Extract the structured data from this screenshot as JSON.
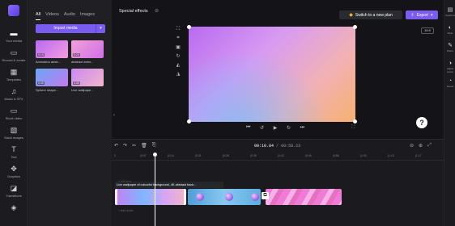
{
  "left_nav": [
    {
      "icon": "folder-icon",
      "label": "Your media",
      "glyph": "▬"
    },
    {
      "icon": "record-icon",
      "label": "Record & create",
      "glyph": "▭"
    },
    {
      "icon": "templates-icon",
      "label": "Templates",
      "glyph": "▦"
    },
    {
      "icon": "music-icon",
      "label": "Music & SFX",
      "glyph": "♫"
    },
    {
      "icon": "stock-video-icon",
      "label": "Stock video",
      "glyph": "▭"
    },
    {
      "icon": "stock-images-icon",
      "label": "Stock images",
      "glyph": "▧"
    },
    {
      "icon": "text-icon",
      "label": "Text",
      "glyph": "T"
    },
    {
      "icon": "graphics-icon",
      "label": "Graphics",
      "glyph": "✥"
    },
    {
      "icon": "transitions-icon",
      "label": "Transitions",
      "glyph": "◪"
    },
    {
      "icon": "brand-icon",
      "label": "",
      "glyph": "◈"
    }
  ],
  "media_panel": {
    "tabs": [
      "All",
      "Videos",
      "Audio",
      "Images"
    ],
    "import_label": "Import media",
    "items": [
      {
        "name": "Animation abstr...",
        "duration": "0:19",
        "gradient": "linear-gradient(135deg,#b86af5,#f59adf)"
      },
      {
        "name": "abstract anim...",
        "duration": "0:20",
        "gradient": "linear-gradient(135deg,#f3a0d8,#d070e8)"
      },
      {
        "name": "Sphere shape...",
        "duration": "0:30",
        "gradient": "linear-gradient(135deg,#6aa6f5,#c27af0)"
      },
      {
        "name": "Live wallpape...",
        "duration": "0:30",
        "gradient": "linear-gradient(135deg,#c98af5,#f3b4c8)"
      }
    ]
  },
  "top_bar": {
    "title": "Special effects",
    "plan_label": "Switch to a new plan",
    "export_label": "Export"
  },
  "preview": {
    "aspect_ratio": "16:9"
  },
  "right_panel": [
    {
      "icon": "captions-icon",
      "label": "Captions",
      "glyph": "▤"
    },
    {
      "icon": "fade-icon",
      "label": "Fade",
      "glyph": "◐"
    },
    {
      "icon": "filters-icon",
      "label": "Filters",
      "glyph": "✎"
    },
    {
      "icon": "adjust-colors-icon",
      "label": "Adjust colors",
      "glyph": "◑"
    },
    {
      "icon": "speed-icon",
      "label": "Speed",
      "glyph": "◔"
    }
  ],
  "timeline": {
    "current_time": "00:10.84",
    "total_time": "00:58.23",
    "ruler_ticks": [
      "0",
      "|0:07",
      "|0:14",
      "|0:21",
      "|0:28",
      "|0:35",
      "|0:42",
      "|0:49",
      "|0:56",
      "|1:03",
      "|1:10",
      "|1:17"
    ],
    "clip_title": "Live wallpaper of colourful background, 4K abstract back...",
    "text_track_hint": "+ Add text",
    "audio_track_hint": "+ Add audio"
  }
}
